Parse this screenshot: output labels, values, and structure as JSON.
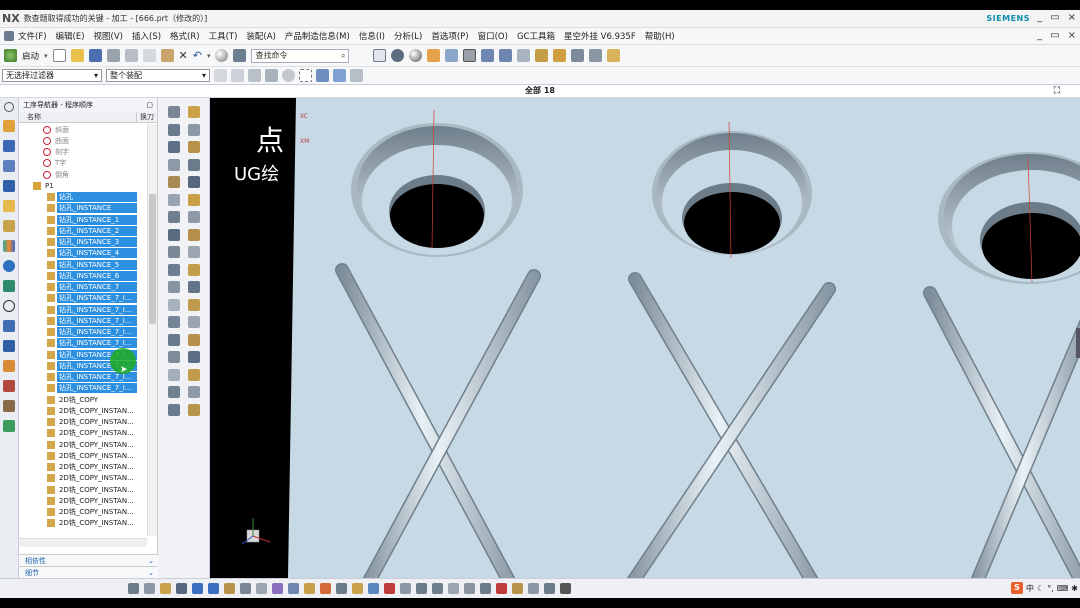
{
  "window": {
    "app_logo": "NX",
    "title": "数查题取得成功的关键 - 加工 - [666.prt（修改的）]",
    "brand": "SIEMENS",
    "controls": [
      "_",
      "▭",
      "×"
    ]
  },
  "menu": {
    "items": [
      "文件(F)",
      "编辑(E)",
      "视图(V)",
      "插入(S)",
      "格式(R)",
      "工具(T)",
      "装配(A)",
      "产品制造信息(M)",
      "信息(I)",
      "分析(L)",
      "首选项(P)",
      "窗口(O)",
      "GC工具箱",
      "星空外挂 V6.935F",
      "帮助(H)"
    ]
  },
  "toolbar": {
    "start_label": "启动",
    "search_placeholder": "查找命令"
  },
  "filters": {
    "selection_filter": "无选择过滤器",
    "assembly_scope": "整个装配"
  },
  "status": {
    "view_label": "全部 18"
  },
  "navigator": {
    "title": "工序导航器 - 程序顺序",
    "col_name": "名称",
    "col_swap": "换刀",
    "rows": [
      {
        "label": "斜面",
        "indent": 24,
        "state": "dim"
      },
      {
        "label": "曲面",
        "indent": 24,
        "state": "dim"
      },
      {
        "label": "刻字",
        "indent": 24,
        "state": "dim"
      },
      {
        "label": "T字",
        "indent": 24,
        "state": "dim"
      },
      {
        "label": "倒角",
        "indent": 24,
        "state": "dim"
      },
      {
        "label": "P1",
        "indent": 14,
        "state": "normal"
      },
      {
        "label": "钻孔",
        "indent": 28,
        "state": "sel"
      },
      {
        "label": "钻孔_INSTANCE",
        "indent": 28,
        "state": "sel"
      },
      {
        "label": "钻孔_INSTANCE_1",
        "indent": 28,
        "state": "sel"
      },
      {
        "label": "钻孔_INSTANCE_2",
        "indent": 28,
        "state": "sel"
      },
      {
        "label": "钻孔_INSTANCE_3",
        "indent": 28,
        "state": "sel"
      },
      {
        "label": "钻孔_INSTANCE_4",
        "indent": 28,
        "state": "sel"
      },
      {
        "label": "钻孔_INSTANCE_5",
        "indent": 28,
        "state": "sel"
      },
      {
        "label": "钻孔_INSTANCE_6",
        "indent": 28,
        "state": "sel"
      },
      {
        "label": "钻孔_INSTANCE_7",
        "indent": 28,
        "state": "sel"
      },
      {
        "label": "钻孔_INSTANCE_7_I...",
        "indent": 28,
        "state": "sel"
      },
      {
        "label": "钻孔_INSTANCE_7_I...",
        "indent": 28,
        "state": "sel"
      },
      {
        "label": "钻孔_INSTANCE_7_I...",
        "indent": 28,
        "state": "sel"
      },
      {
        "label": "钻孔_INSTANCE_7_I...",
        "indent": 28,
        "state": "sel"
      },
      {
        "label": "钻孔_INSTANCE_7_I...",
        "indent": 28,
        "state": "sel"
      },
      {
        "label": "钻孔_INSTANCE_7_I...",
        "indent": 28,
        "state": "sel"
      },
      {
        "label": "钻孔_INSTANCE_7_I...",
        "indent": 28,
        "state": "sel"
      },
      {
        "label": "钻孔_INSTANCE_7_I...",
        "indent": 28,
        "state": "sel"
      },
      {
        "label": "钻孔_INSTANCE_7_I...",
        "indent": 28,
        "state": "sel"
      },
      {
        "label": "2D铣_COPY",
        "indent": 28,
        "state": "normal"
      },
      {
        "label": "2D铣_COPY_INSTAN...",
        "indent": 28,
        "state": "normal"
      },
      {
        "label": "2D铣_COPY_INSTAN...",
        "indent": 28,
        "state": "normal"
      },
      {
        "label": "2D铣_COPY_INSTAN...",
        "indent": 28,
        "state": "normal"
      },
      {
        "label": "2D铣_COPY_INSTAN...",
        "indent": 28,
        "state": "normal"
      },
      {
        "label": "2D铣_COPY_INSTAN...",
        "indent": 28,
        "state": "normal"
      },
      {
        "label": "2D铣_COPY_INSTAN...",
        "indent": 28,
        "state": "normal"
      },
      {
        "label": "2D铣_COPY_INSTAN...",
        "indent": 28,
        "state": "normal"
      },
      {
        "label": "2D铣_COPY_INSTAN...",
        "indent": 28,
        "state": "normal"
      },
      {
        "label": "2D铣_COPY_INSTAN...",
        "indent": 28,
        "state": "normal"
      },
      {
        "label": "2D铣_COPY_INSTAN...",
        "indent": 28,
        "state": "normal"
      },
      {
        "label": "2D铣_COPY_INSTAN...",
        "indent": 28,
        "state": "normal"
      }
    ],
    "footer_dependency": "相依性",
    "footer_details": "细节"
  },
  "viewport": {
    "overlay_text_1": "点",
    "overlay_text_2": "UG绘",
    "axis_label_xc": "XC",
    "axis_label_xm": "XM"
  },
  "ime": {
    "logo": "S",
    "lang": "中"
  },
  "colors": {
    "selection": "#2d8fe0",
    "model_surface": "#c5d9e6",
    "cursor": "#1aa81a",
    "brand": "#0b8fa8"
  }
}
